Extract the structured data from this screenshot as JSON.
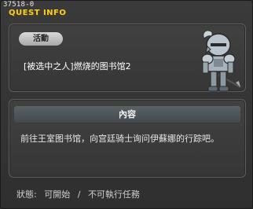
{
  "quest_id": "37518-0",
  "window_title": "QUEST INFO",
  "badge_label": "活動",
  "quest_name": "[被选中之人]燃烧的图书馆2",
  "content_header": "內容",
  "content_text": "前往王室图书馆，向宫廷骑士询问伊蘇娜的行踪吧。",
  "status": {
    "label": "狀態:",
    "available": "可開始",
    "separator": "/",
    "unavailable": "不可執行任務"
  },
  "icons": {
    "character": "armored-knight-icon"
  },
  "colors": {
    "title": "#f5d02a",
    "panel_bg": "#3a3a3a",
    "badge_bg": "#c8c8c8"
  }
}
